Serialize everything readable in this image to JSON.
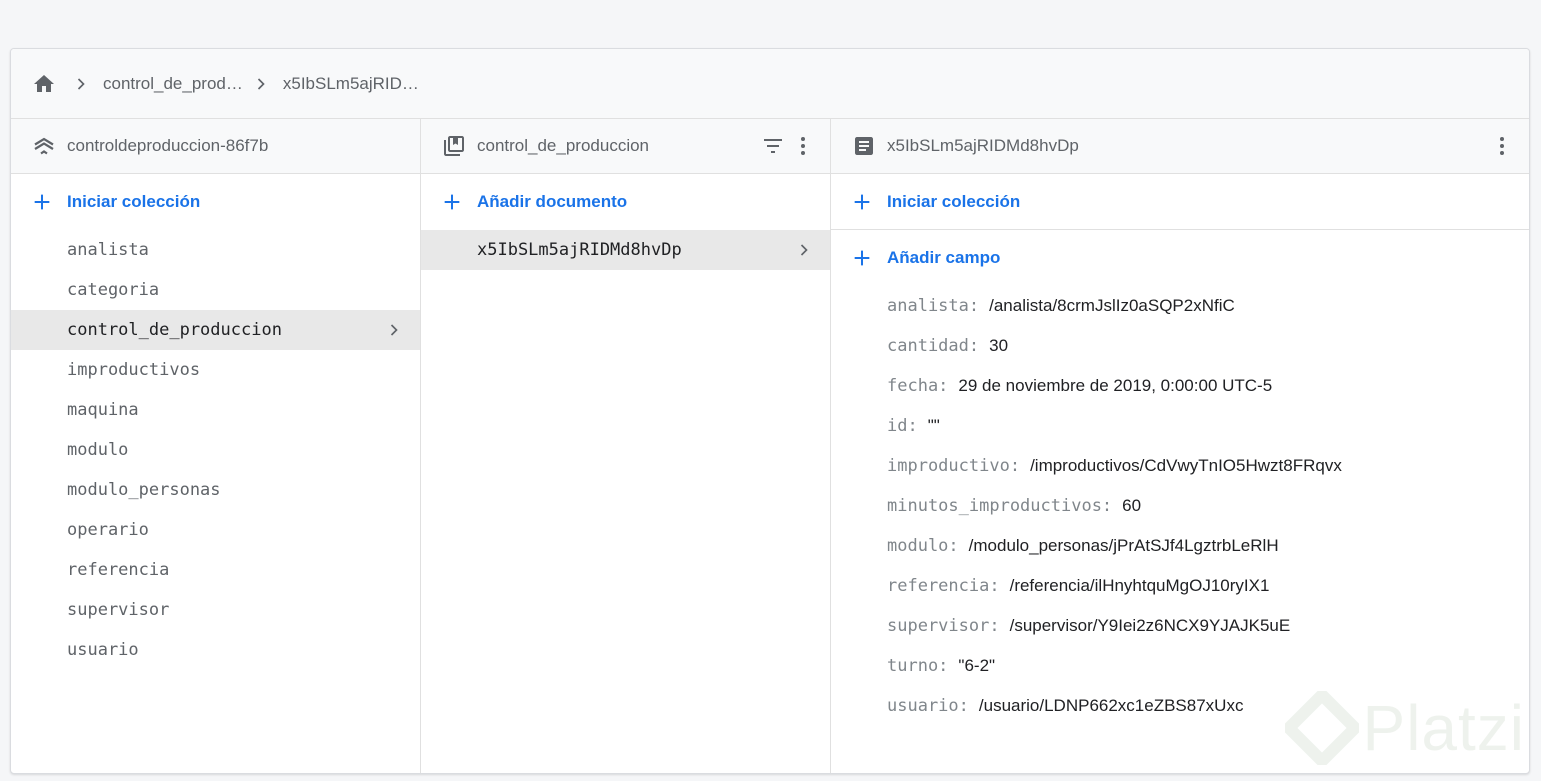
{
  "breadcrumb": {
    "home_icon": "home-icon",
    "items": [
      "control_de_prod…",
      "x5IbSLm5ajRID…"
    ]
  },
  "columns": {
    "project": {
      "title": "controldeproduccion-86f7b",
      "icon": "firestore-database-icon",
      "action": "Iniciar colección",
      "collections": [
        "analista",
        "categoria",
        "control_de_produccion",
        "improductivos",
        "maquina",
        "modulo",
        "modulo_personas",
        "operario",
        "referencia",
        "supervisor",
        "usuario"
      ],
      "selected_index": 2
    },
    "collection": {
      "title": "control_de_produccion",
      "icon": "collection-icon",
      "action": "Añadir documento",
      "documents": [
        "x5IbSLm5ajRIDMd8hvDp"
      ],
      "selected_index": 0
    },
    "document": {
      "title": "x5IbSLm5ajRIDMd8hvDp",
      "icon": "document-icon",
      "action_collection": "Iniciar colección",
      "action_field": "Añadir campo",
      "fields": [
        {
          "key": "analista:",
          "value": "/analista/8crmJslIz0aSQP2xNfiC"
        },
        {
          "key": "cantidad:",
          "value": "30"
        },
        {
          "key": "fecha:",
          "value": "29 de noviembre de 2019, 0:00:00 UTC-5"
        },
        {
          "key": "id:",
          "value": "\"\""
        },
        {
          "key": "improductivo:",
          "value": "/improductivos/CdVwyTnIO5Hwzt8FRqvx"
        },
        {
          "key": "minutos_improductivos:",
          "value": "60"
        },
        {
          "key": "modulo:",
          "value": "/modulo_personas/jPrAtSJf4LgztrbLeRlH"
        },
        {
          "key": "referencia:",
          "value": "/referencia/ilHnyhtquMgOJ10ryIX1"
        },
        {
          "key": "supervisor:",
          "value": "/supervisor/Y9Iei2z6NCX9YJAJK5uE"
        },
        {
          "key": "turno:",
          "value": "\"6-2\""
        },
        {
          "key": "usuario:",
          "value": "/usuario/LDNP662xc1eZBS87xUxc"
        }
      ]
    }
  },
  "watermark": {
    "text": "Platzi"
  },
  "colors": {
    "accent": "#1a73e8",
    "selected_bg": "#e8e8e8",
    "header_bg": "#f8f9fa"
  }
}
